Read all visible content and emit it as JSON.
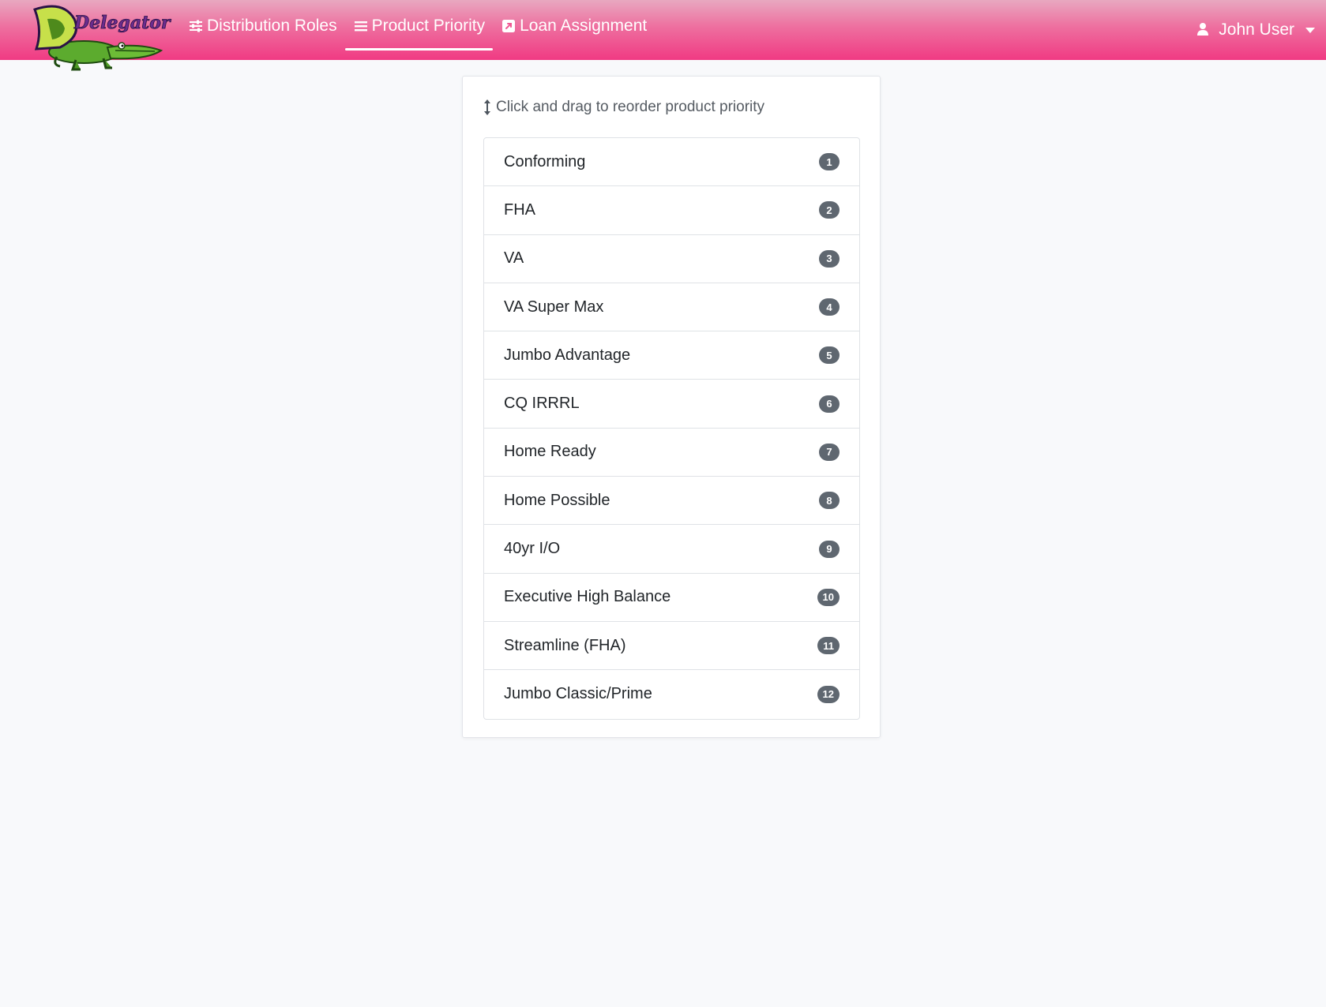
{
  "app": {
    "logo_text": "Delegator",
    "colors": {
      "navbar_top": "#e8a8c0",
      "navbar_bottom": "#f03a83",
      "badge": "#5f6770",
      "page_background": "#f8f9fb"
    }
  },
  "nav": {
    "links": [
      {
        "label": "Distribution Roles",
        "icon": "sliders-icon",
        "active": false
      },
      {
        "label": "Product Priority",
        "icon": "list-icon",
        "active": true
      },
      {
        "label": "Loan Assignment",
        "icon": "external-link-icon",
        "active": false
      }
    ],
    "user": {
      "name": "John User",
      "icon": "user-icon"
    }
  },
  "card": {
    "hint": "Click and drag to reorder product priority",
    "hint_icon": "vertical-arrows-icon",
    "items": [
      {
        "label": "Conforming",
        "rank": "1"
      },
      {
        "label": "FHA",
        "rank": "2"
      },
      {
        "label": "VA",
        "rank": "3"
      },
      {
        "label": "VA Super Max",
        "rank": "4"
      },
      {
        "label": "Jumbo Advantage",
        "rank": "5"
      },
      {
        "label": "CQ IRRRL",
        "rank": "6"
      },
      {
        "label": "Home Ready",
        "rank": "7"
      },
      {
        "label": "Home Possible",
        "rank": "8"
      },
      {
        "label": "40yr I/O",
        "rank": "9"
      },
      {
        "label": "Executive High Balance",
        "rank": "10"
      },
      {
        "label": "Streamline (FHA)",
        "rank": "11"
      },
      {
        "label": "Jumbo Classic/Prime",
        "rank": "12"
      }
    ]
  }
}
